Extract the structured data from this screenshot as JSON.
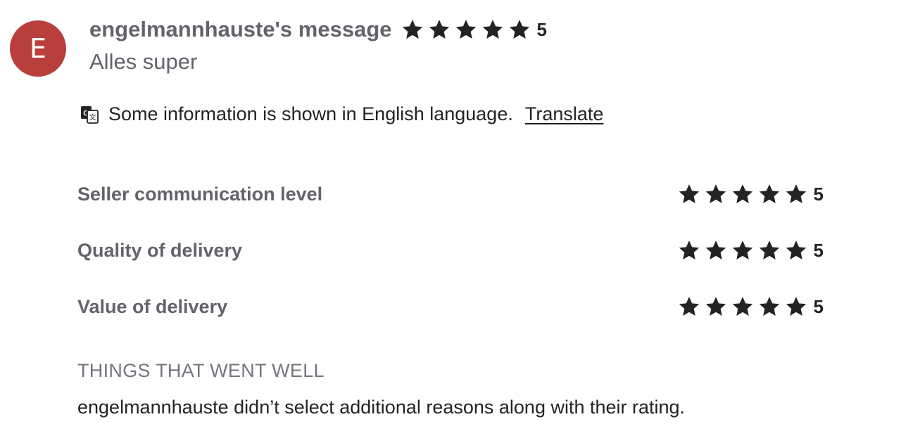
{
  "avatar": {
    "initial": "E",
    "color": "#b93f3c"
  },
  "review": {
    "title": "engelmannhauste's message",
    "rating": 5,
    "rating_label": "5",
    "text": "Alles super"
  },
  "translate": {
    "icon": "translate-icon",
    "message": "Some information is shown in English language.",
    "link_label": "Translate"
  },
  "criteria": [
    {
      "label": "Seller communication level",
      "rating": 5,
      "rating_label": "5"
    },
    {
      "label": "Quality of delivery",
      "rating": 5,
      "rating_label": "5"
    },
    {
      "label": "Value of delivery",
      "rating": 5,
      "rating_label": "5"
    }
  ],
  "things_went_well": {
    "heading": "THINGS THAT WENT WELL",
    "text": "engelmannhauste didn’t select additional reasons along with their rating."
  },
  "colors": {
    "star": "#222325",
    "muted_text": "#62646a",
    "heading_text": "#74767e",
    "body_text": "#222325"
  }
}
